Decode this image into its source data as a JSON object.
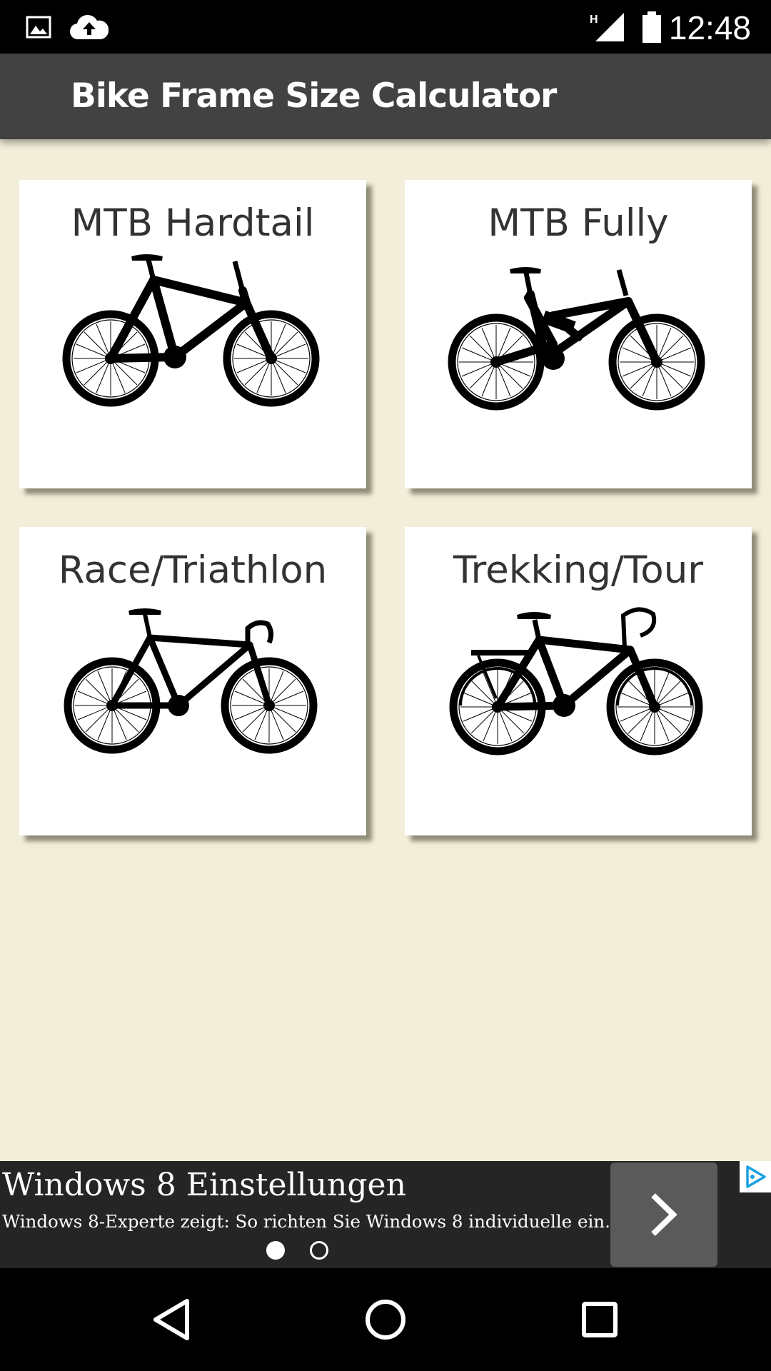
{
  "status_bar": {
    "time": "12:48",
    "left_icons": [
      "image-icon",
      "cloud-upload-icon"
    ],
    "right_icons": [
      "signal-h-icon",
      "battery-icon"
    ],
    "network_type": "H"
  },
  "app_bar": {
    "title": "Bike Frame Size Calculator"
  },
  "bike_types": [
    {
      "label": "MTB Hardtail",
      "icon": "hardtail-bike-icon"
    },
    {
      "label": "MTB Fully",
      "icon": "full-suspension-bike-icon"
    },
    {
      "label": "Race/Triathlon",
      "icon": "road-bike-icon"
    },
    {
      "label": "Trekking/Tour",
      "icon": "trekking-bike-icon"
    }
  ],
  "ad": {
    "title": "Windows 8 Einstellungen",
    "description": "Windows 8-Experte zeigt: So richten Sie Windows 8 individuelle ein.",
    "pages": 2,
    "active_page": 1
  },
  "colors": {
    "background": "#f2eed9",
    "app_bar": "#424242",
    "ad_bar": "#252525",
    "ad_choice_accent": "#1aa1e1"
  }
}
